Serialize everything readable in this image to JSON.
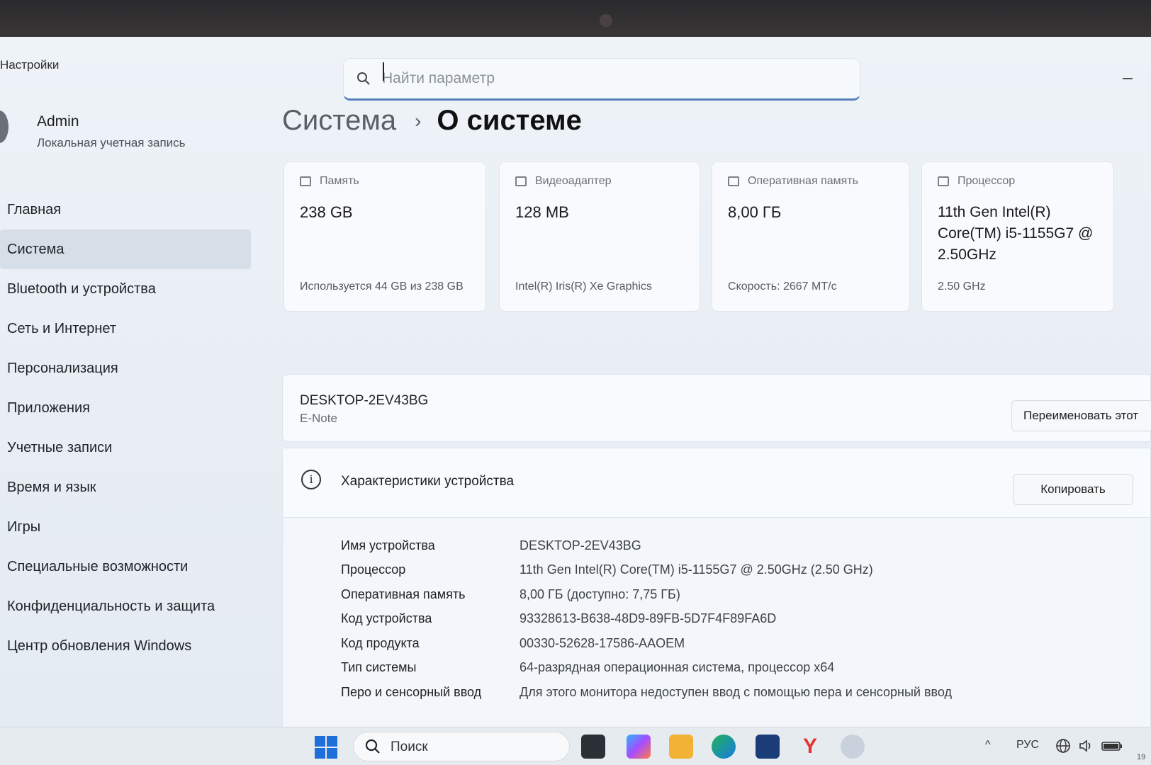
{
  "app": {
    "title": "Настройки"
  },
  "search": {
    "placeholder": "Найти параметр"
  },
  "user": {
    "name": "Admin",
    "account_type": "Локальная учетная запись"
  },
  "sidebar": {
    "items": [
      {
        "label": "Главная",
        "active": false
      },
      {
        "label": "Система",
        "active": true
      },
      {
        "label": "Bluetooth и устройства",
        "active": false
      },
      {
        "label": "Сеть и Интернет",
        "active": false
      },
      {
        "label": "Персонализация",
        "active": false
      },
      {
        "label": "Приложения",
        "active": false
      },
      {
        "label": "Учетные записи",
        "active": false
      },
      {
        "label": "Время и язык",
        "active": false
      },
      {
        "label": "Игры",
        "active": false
      },
      {
        "label": "Специальные возможности",
        "active": false
      },
      {
        "label": "Конфиденциальность и защита",
        "active": false
      },
      {
        "label": "Центр обновления Windows",
        "active": false
      }
    ]
  },
  "breadcrumb": {
    "parent": "Система",
    "separator": "›",
    "current": "О системе"
  },
  "cards": [
    {
      "label": "Память",
      "value": "238 GB",
      "detail": "Используется 44 GB из 238 GB",
      "icon": "storage-icon"
    },
    {
      "label": "Видеоадаптер",
      "value": "128 MB",
      "detail": "Intel(R) Iris(R) Xe Graphics",
      "icon": "gpu-icon"
    },
    {
      "label": "Оперативная память",
      "value": "8,00 ГБ",
      "detail": "Скорость: 2667 MT/c",
      "icon": "ram-icon"
    },
    {
      "label": "Процессор",
      "value": "11th Gen Intel(R) Core(TM) i5-1155G7 @ 2.50GHz",
      "detail": "2.50 GHz",
      "icon": "cpu-icon"
    }
  ],
  "device": {
    "name": "DESKTOP-2EV43BG",
    "model": "E-Note",
    "rename_button": "Переименовать этот"
  },
  "specs": {
    "title": "Характеристики устройства",
    "copy_button": "Копировать",
    "rows": [
      {
        "key": "Имя устройства",
        "value": "DESKTOP-2EV43BG"
      },
      {
        "key": "Процессор",
        "value": "11th Gen Intel(R) Core(TM) i5-1155G7 @ 2.50GHz (2.50 GHz)"
      },
      {
        "key": "Оперативная память",
        "value": "8,00 ГБ (доступно: 7,75 ГБ)"
      },
      {
        "key": "Код устройства",
        "value": "93328613-B638-48D9-89FB-5D7F4F89FA6D"
      },
      {
        "key": "Код продукта",
        "value": "00330-52628-17586-AAOEM"
      },
      {
        "key": "Тип системы",
        "value": "64-разрядная операционная система, процессор x64"
      },
      {
        "key": "Перо и сенсорный ввод",
        "value": "Для этого монитора недоступен ввод с помощью пера и сенсорный ввод"
      }
    ]
  },
  "taskbar": {
    "search_label": "Поиск",
    "apps": [
      "task-view-icon",
      "m365-icon",
      "file-explorer-icon",
      "edge-icon",
      "store-icon",
      "yandex-browser-icon",
      "settings-icon"
    ],
    "language": "РУС",
    "clock_fragment": "19"
  },
  "colors": {
    "accent": "#1e6fd9",
    "search_underline": "#5a7fbd"
  }
}
